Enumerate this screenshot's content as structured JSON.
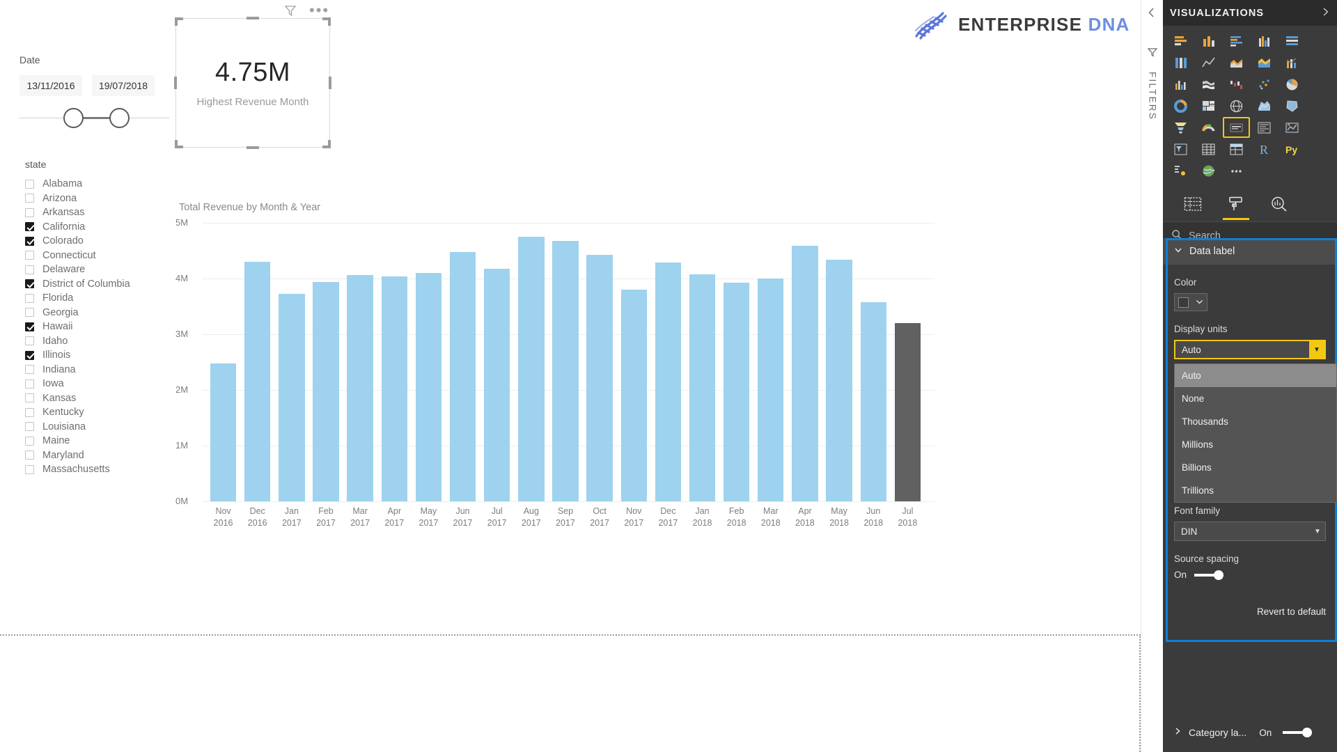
{
  "logo": {
    "part_a": "ENTERPRISE",
    "part_b": "DNA",
    "icon": "dna-helix-icon",
    "color_a": "#3b3b3b",
    "color_b": "#6d8ee0"
  },
  "date_slicer": {
    "title": "Date",
    "start": "13/11/2016",
    "end": "19/07/2018"
  },
  "state_slicer": {
    "title": "state",
    "items": [
      {
        "label": "Alabama",
        "checked": false
      },
      {
        "label": "Arizona",
        "checked": false
      },
      {
        "label": "Arkansas",
        "checked": false
      },
      {
        "label": "California",
        "checked": true
      },
      {
        "label": "Colorado",
        "checked": true
      },
      {
        "label": "Connecticut",
        "checked": false
      },
      {
        "label": "Delaware",
        "checked": false
      },
      {
        "label": "District of Columbia",
        "checked": true
      },
      {
        "label": "Florida",
        "checked": false
      },
      {
        "label": "Georgia",
        "checked": false
      },
      {
        "label": "Hawaii",
        "checked": true
      },
      {
        "label": "Idaho",
        "checked": false
      },
      {
        "label": "Illinois",
        "checked": true
      },
      {
        "label": "Indiana",
        "checked": false
      },
      {
        "label": "Iowa",
        "checked": false
      },
      {
        "label": "Kansas",
        "checked": false
      },
      {
        "label": "Kentucky",
        "checked": false
      },
      {
        "label": "Louisiana",
        "checked": false
      },
      {
        "label": "Maine",
        "checked": false
      },
      {
        "label": "Maryland",
        "checked": false
      },
      {
        "label": "Massachusetts",
        "checked": false
      }
    ]
  },
  "card": {
    "value": "4.75M",
    "label": "Highest Revenue Month"
  },
  "visual_header": {
    "filter_icon": "filter-funnel-icon",
    "more_icon": "more-options-ellipsis"
  },
  "chart_data": {
    "type": "bar",
    "title": "Total Revenue by Month & Year",
    "xlabel": "",
    "ylabel": "",
    "ylim": [
      0,
      5000000
    ],
    "ytick_labels": [
      "5M",
      "4M",
      "3M",
      "2M",
      "1M",
      "0M"
    ],
    "ytick_values": [
      5000000,
      4000000,
      3000000,
      2000000,
      1000000,
      0
    ],
    "grid": true,
    "legend": "none",
    "bar_color": "#9ed2ee",
    "selected_bar_color": "#616161",
    "selected_index": 20,
    "categories": [
      "Nov 2016",
      "Dec 2016",
      "Jan 2017",
      "Feb 2017",
      "Mar 2017",
      "Apr 2017",
      "May 2017",
      "Jun 2017",
      "Jul 2017",
      "Aug 2017",
      "Sep 2017",
      "Oct 2017",
      "Nov 2017",
      "Dec 2017",
      "Jan 2018",
      "Feb 2018",
      "Mar 2018",
      "Apr 2018",
      "May 2018",
      "Jun 2018",
      "Jul 2018"
    ],
    "category_months": [
      "Nov",
      "Dec",
      "Jan",
      "Feb",
      "Mar",
      "Apr",
      "May",
      "Jun",
      "Jul",
      "Aug",
      "Sep",
      "Oct",
      "Nov",
      "Dec",
      "Jan",
      "Feb",
      "Mar",
      "Apr",
      "May",
      "Jun",
      "Jul"
    ],
    "category_years": [
      "2016",
      "2016",
      "2017",
      "2017",
      "2017",
      "2017",
      "2017",
      "2017",
      "2017",
      "2017",
      "2017",
      "2017",
      "2017",
      "2017",
      "2018",
      "2018",
      "2018",
      "2018",
      "2018",
      "2018",
      "2018"
    ],
    "values": [
      2480000,
      4300000,
      3720000,
      3940000,
      4060000,
      4040000,
      4100000,
      4480000,
      4180000,
      4750000,
      4680000,
      4420000,
      3800000,
      4290000,
      4070000,
      3930000,
      4000000,
      4590000,
      4340000,
      3580000,
      3200000
    ]
  },
  "right_rail": {
    "collapse_icon": "chevron-left-icon",
    "filters_label": "FILTERS",
    "filters_icon": "filter-pane-icon"
  },
  "viz_pane": {
    "title": "VISUALIZATIONS",
    "expand_icon": "chevron-right-icon",
    "gallery": [
      {
        "name": "stacked-bar-chart-icon",
        "selected": false
      },
      {
        "name": "stacked-column-chart-icon",
        "selected": false
      },
      {
        "name": "clustered-bar-chart-icon",
        "selected": false
      },
      {
        "name": "clustered-column-chart-icon",
        "selected": false
      },
      {
        "name": "100-stacked-bar-chart-icon",
        "selected": false
      },
      {
        "name": "100-stacked-column-chart-icon",
        "selected": false
      },
      {
        "name": "line-chart-icon",
        "selected": false
      },
      {
        "name": "area-chart-icon",
        "selected": false
      },
      {
        "name": "stacked-area-chart-icon",
        "selected": false
      },
      {
        "name": "line-and-stacked-column-chart-icon",
        "selected": false
      },
      {
        "name": "line-and-clustered-column-chart-icon",
        "selected": false
      },
      {
        "name": "ribbon-chart-icon",
        "selected": false
      },
      {
        "name": "waterfall-chart-icon",
        "selected": false
      },
      {
        "name": "scatter-chart-icon",
        "selected": false
      },
      {
        "name": "pie-chart-icon",
        "selected": false
      },
      {
        "name": "donut-chart-icon",
        "selected": false
      },
      {
        "name": "treemap-icon",
        "selected": false
      },
      {
        "name": "map-icon",
        "selected": false
      },
      {
        "name": "filled-map-icon",
        "selected": false
      },
      {
        "name": "shape-map-icon",
        "selected": false
      },
      {
        "name": "funnel-chart-icon",
        "selected": false
      },
      {
        "name": "gauge-chart-icon",
        "selected": false
      },
      {
        "name": "card-icon",
        "selected": true
      },
      {
        "name": "multi-row-card-icon",
        "selected": false
      },
      {
        "name": "kpi-icon",
        "selected": false
      },
      {
        "name": "slicer-icon",
        "selected": false
      },
      {
        "name": "table-icon",
        "selected": false
      },
      {
        "name": "matrix-icon",
        "selected": false
      },
      {
        "name": "r-script-visual-icon",
        "selected": false
      },
      {
        "name": "python-visual-icon",
        "selected": false
      },
      {
        "name": "key-influencers-icon",
        "selected": false
      },
      {
        "name": "arcgis-maps-icon",
        "selected": false
      },
      {
        "name": "more-visuals-ellipsis-icon",
        "selected": false
      }
    ],
    "tabs": [
      {
        "name": "fields-tab",
        "icon": "fields-table-icon",
        "active": false
      },
      {
        "name": "format-tab",
        "icon": "paint-roller-icon",
        "active": true
      },
      {
        "name": "analytics-tab",
        "icon": "analytics-magnifier-icon",
        "active": false
      }
    ],
    "search": {
      "placeholder": "Search",
      "icon": "search-magnifier-icon"
    }
  },
  "format_pane": {
    "section": {
      "label": "Data label",
      "expanded": true,
      "chevron": "chevron-down-icon"
    },
    "color": {
      "label": "Color",
      "swatch_hex": "#3a3a3a",
      "dropdown_icon": "chevron-down-icon"
    },
    "display_units": {
      "label": "Display units",
      "value": "Auto",
      "open": true,
      "options": [
        "Auto",
        "None",
        "Thousands",
        "Millions",
        "Billions",
        "Trillions"
      ],
      "hovered_option": "Auto"
    },
    "font_family": {
      "label": "Font family",
      "value": "DIN",
      "dropdown_icon": "chevron-down-icon"
    },
    "source_spacing": {
      "label": "Source spacing",
      "state": "On"
    },
    "revert": "Revert to default",
    "collapsed_section": {
      "label": "Category la...",
      "state": "On",
      "chevron": "chevron-right-icon"
    },
    "focus_color": "#0f7fd6",
    "highlight_color": "#f2c811"
  }
}
